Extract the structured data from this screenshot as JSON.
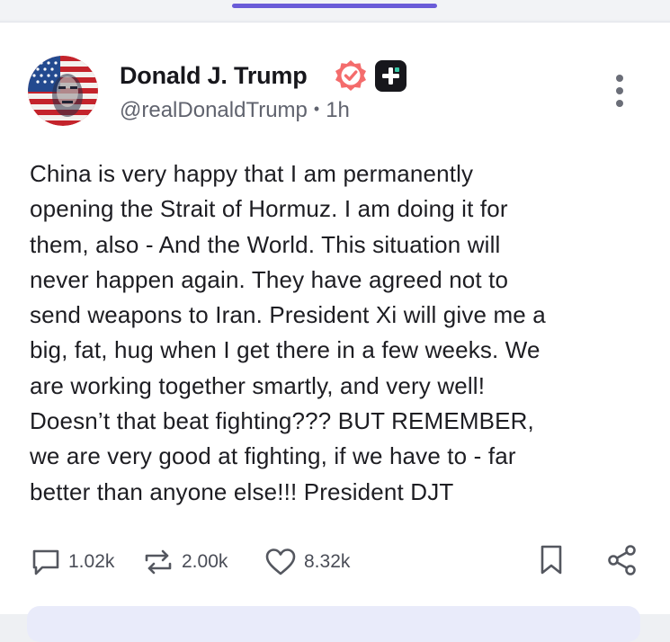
{
  "post": {
    "author": {
      "display_name": "Donald J. Trump",
      "handle": "@realDonaldTrump",
      "separator": "•",
      "time_ago": "1h",
      "avatar_icon": "flag-portrait-avatar",
      "verified_icon": "verified-badge-icon",
      "plus_icon": "truth-plus-icon"
    },
    "body_lines": [
      "China is very happy that I am permanently",
      "opening the Strait of Hormuz. I am doing it for",
      "them, also - And the World. This situation will",
      "never happen again. They have agreed not to",
      "send weapons to Iran. President Xi will give me a",
      "big, fat, hug when I get there in a few weeks. We",
      "are working together smartly, and very well!",
      "Doesn’t that beat fighting??? BUT REMEMBER,",
      "we are very good at fighting, if we have to - far",
      "better than anyone else!!! President DJT"
    ],
    "actions": {
      "replies": "1.02k",
      "retruths": "2.00k",
      "likes": "8.32k"
    }
  },
  "colors": {
    "accent": "#6a5bd8",
    "verified": "#f46c6c",
    "text": "#1d1d22",
    "muted": "#60636e",
    "icon": "#54575f"
  }
}
